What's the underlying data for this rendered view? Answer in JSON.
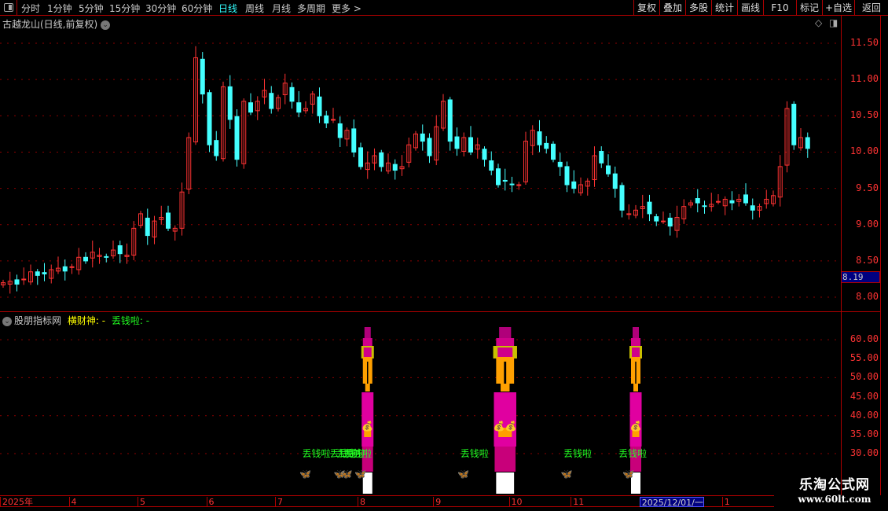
{
  "toolbar": {
    "periods": [
      "分时",
      "1分钟",
      "5分钟",
      "15分钟",
      "30分钟",
      "60分钟",
      "日线",
      "周线",
      "月线",
      "多周期",
      "更多 >"
    ],
    "active_period": "日线",
    "buttons": [
      "复权",
      "叠加",
      "多股",
      "统计",
      "画线",
      "F10",
      "标记",
      "+自选",
      "返回"
    ]
  },
  "chart": {
    "title": "古越龙山(日线,前复权)",
    "price_ticks": [
      "11.50",
      "11.00",
      "10.50",
      "10.00",
      "9.50",
      "9.00",
      "8.50",
      "8.00"
    ],
    "last_price": "8.19",
    "colors": {
      "up": "#ff3333",
      "down": "#44ffff",
      "grid": "#8b0000",
      "border": "#b00000"
    }
  },
  "chart_data": {
    "type": "candlestick",
    "ylim": [
      7.8,
      11.7
    ],
    "closes": [
      8.2,
      8.22,
      8.18,
      8.25,
      8.35,
      8.3,
      8.32,
      8.38,
      8.4,
      8.36,
      8.42,
      8.55,
      8.5,
      8.62,
      8.58,
      8.55,
      8.65,
      8.6,
      8.58,
      8.95,
      9.15,
      8.85,
      9.05,
      9.1,
      8.95,
      8.95,
      9.45,
      10.2,
      11.3,
      10.8,
      10.1,
      9.95,
      10.9,
      10.45,
      9.9,
      10.7,
      10.55,
      10.7,
      10.85,
      10.6,
      10.75,
      10.95,
      10.7,
      10.55,
      10.6,
      10.8,
      10.5,
      10.4,
      10.45,
      10.2,
      10.3,
      10.0,
      9.8,
      9.85,
      9.95,
      9.8,
      9.85,
      9.75,
      9.8,
      10.1,
      10.25,
      10.15,
      9.95,
      10.35,
      10.7,
      10.15,
      10.05,
      10.2,
      10.0,
      10.1,
      9.9,
      9.75,
      9.55,
      9.6,
      9.55,
      9.55,
      10.15,
      10.3,
      10.1,
      10.05,
      9.9,
      9.8,
      9.55,
      9.5,
      9.55,
      9.6,
      9.95,
      9.85,
      9.7,
      9.5,
      9.2,
      9.15,
      9.2,
      9.25,
      9.15,
      9.05,
      9.05,
      8.98,
      9.1,
      9.25,
      9.3,
      9.3,
      9.25,
      9.28,
      9.32,
      9.35,
      9.3,
      9.35,
      9.3,
      9.2,
      9.25,
      9.35,
      9.4,
      9.8,
      10.6,
      10.1,
      10.2,
      10.05
    ]
  },
  "indicator": {
    "name": "股朋指标网",
    "line1": "横财神: -",
    "line2": "丢钱啦: -",
    "ticks": [
      "60.00",
      "55.00",
      "50.00",
      "45.00",
      "40.00",
      "35.00",
      "30.00"
    ],
    "signal_label": "丢钱啦",
    "big_signals": [
      53,
      73,
      92
    ],
    "big_widths": [
      1,
      2,
      1
    ],
    "label_signals": [
      46,
      50,
      51,
      52,
      69,
      84,
      92
    ],
    "butterfly_signals": [
      44,
      49,
      50,
      52,
      67,
      82,
      91
    ]
  },
  "axis": {
    "labels": [
      {
        "text": "2025年",
        "idx": 0
      },
      {
        "text": "4",
        "idx": 10
      },
      {
        "text": "5",
        "idx": 20
      },
      {
        "text": "6",
        "idx": 30
      },
      {
        "text": "7",
        "idx": 40
      },
      {
        "text": "8",
        "idx": 52
      },
      {
        "text": "9",
        "idx": 63
      },
      {
        "text": "10",
        "idx": 74
      },
      {
        "text": "11",
        "idx": 83
      },
      {
        "text": "2025/12/01/一",
        "idx": 93,
        "highlight": true
      },
      {
        "text": "1",
        "idx": 105
      }
    ]
  },
  "watermark": {
    "name": "乐淘公式网",
    "url": "www.60lt.com"
  }
}
